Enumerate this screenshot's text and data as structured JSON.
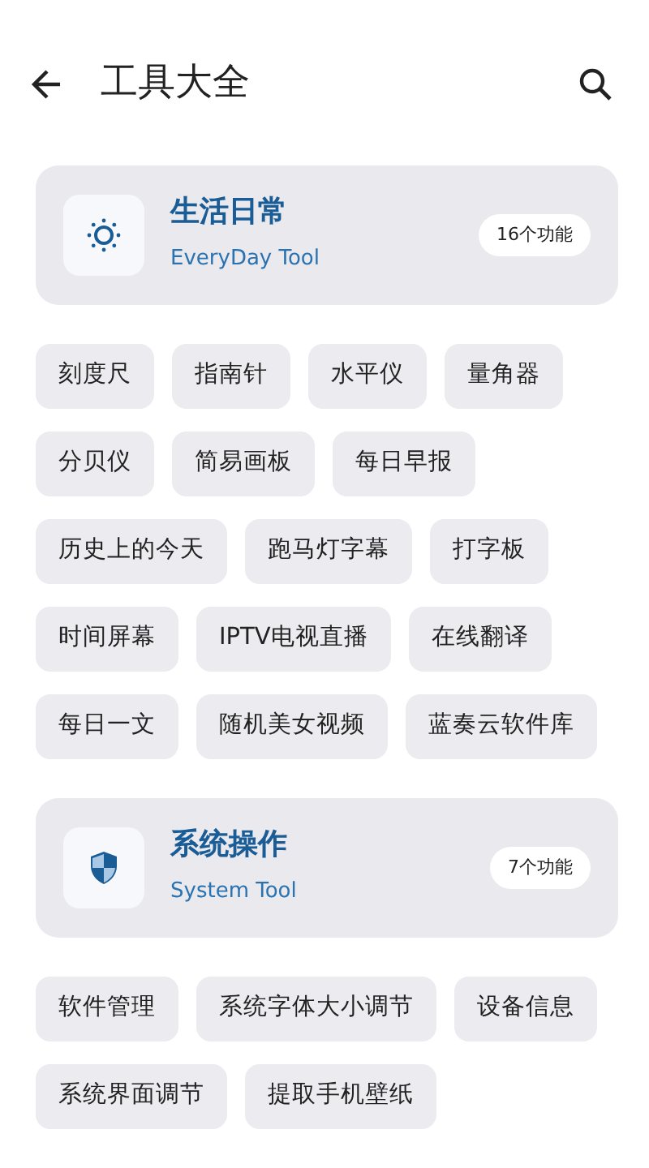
{
  "header": {
    "title": "工具大全"
  },
  "sections": [
    {
      "kind": "sun",
      "title": "生活日常",
      "subtitle": "EveryDay Tool",
      "count": "16个功能",
      "tools": [
        "刻度尺",
        "指南针",
        "水平仪",
        "量角器",
        "分贝仪",
        "简易画板",
        "每日早报",
        "历史上的今天",
        "跑马灯字幕",
        "打字板",
        "时间屏幕",
        "IPTV电视直播",
        "在线翻译",
        "每日一文",
        "随机美女视频",
        "蓝奏云软件库"
      ]
    },
    {
      "kind": "shield",
      "title": "系统操作",
      "subtitle": "System Tool",
      "count": "7个功能",
      "tools": [
        "软件管理",
        "系统字体大小调节",
        "设备信息",
        "系统界面调节",
        "提取手机壁纸"
      ]
    }
  ]
}
